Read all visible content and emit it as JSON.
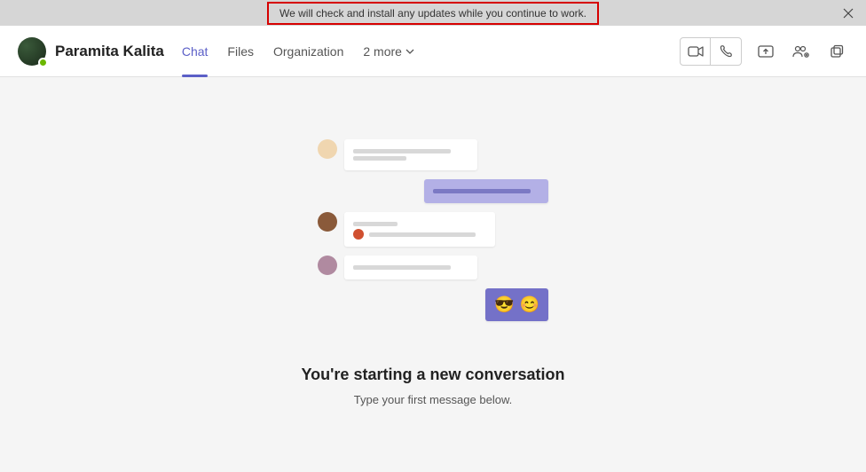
{
  "notification": {
    "text": "We will check and install any updates while you continue to work."
  },
  "contact": {
    "name": "Paramita Kalita"
  },
  "tabs": {
    "chat": "Chat",
    "files": "Files",
    "organization": "Organization",
    "more": "2 more"
  },
  "actions": {
    "video": "video-call-icon",
    "audio": "audio-call-icon",
    "share": "share-screen-icon",
    "add": "add-people-icon",
    "popout": "popout-icon"
  },
  "empty": {
    "title": "You're starting a new conversation",
    "subtitle": "Type your first message below."
  }
}
